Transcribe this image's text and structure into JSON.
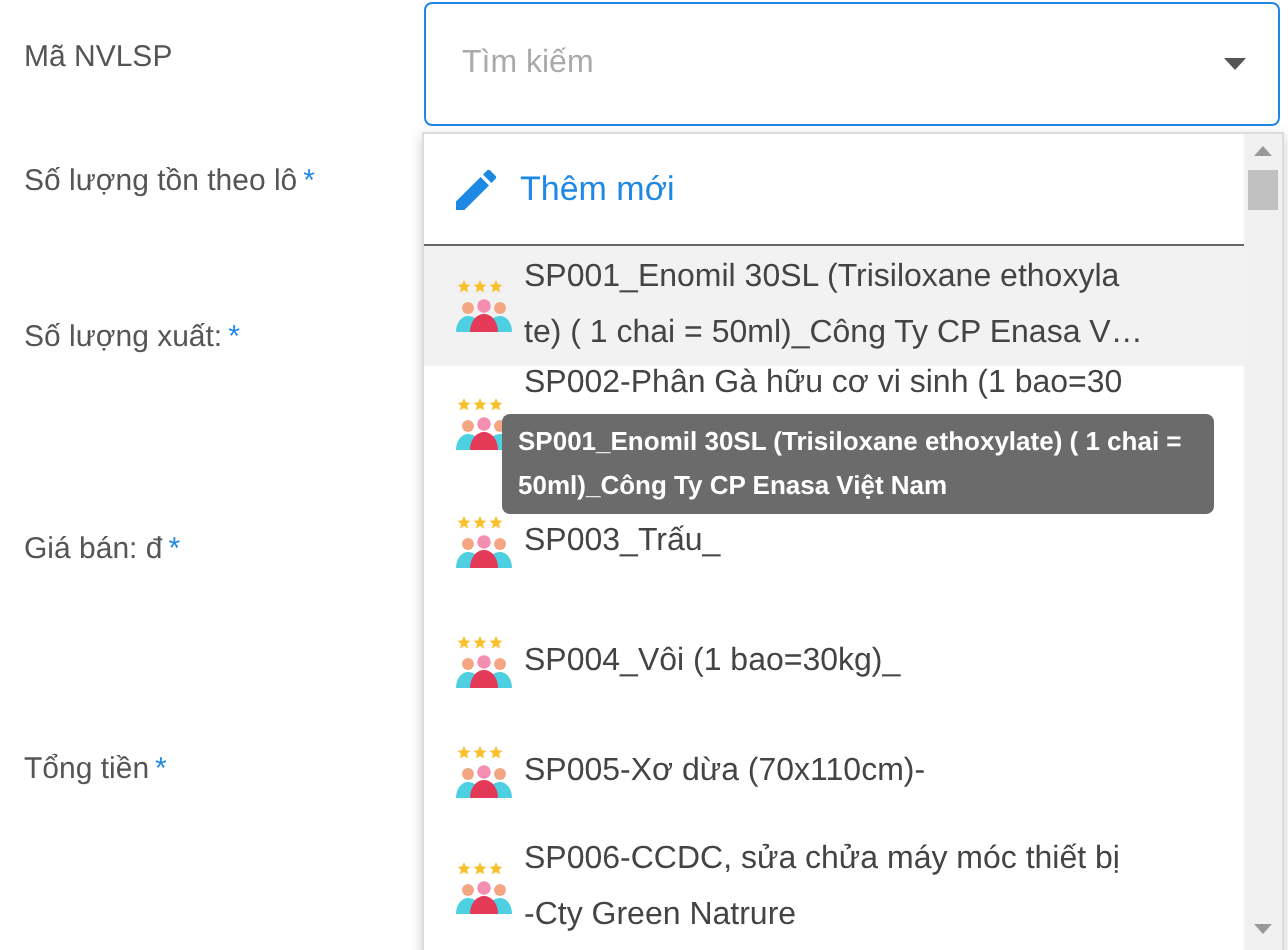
{
  "fields": [
    {
      "label": "Mã NVLSP"
    },
    {
      "label": "Số lượng tồn theo lô",
      "mark": "*"
    },
    {
      "label": "Số lượng xuất:",
      "mark": "*"
    },
    {
      "label": "Giá bán: đ",
      "mark": "*"
    },
    {
      "label": "Tổng tiền",
      "mark": "*"
    }
  ],
  "select": {
    "placeholder": "Tìm kiếm",
    "expanded": true
  },
  "dropdown": {
    "add_label": "Thêm mới",
    "items": [
      {
        "lines": [
          "SP001_Enomil 30SL (Trisiloxane ethoxyla",
          "te) ( 1 chai = 50ml)_Công Ty CP Enasa V…"
        ],
        "selected": true
      },
      {
        "lines": [
          "SP002-Phân Gà hữu cơ vi sinh (1 bao=30"
        ],
        "selected": false
      },
      {
        "lines": [
          "SP003_Trấu_"
        ],
        "selected": false
      },
      {
        "lines": [
          "SP004_Vôi (1 bao=30kg)_"
        ],
        "selected": false
      },
      {
        "lines": [
          "SP005-Xơ dừa (70x110cm)-"
        ],
        "selected": false
      },
      {
        "lines": [
          "SP006-CCDC, sửa chửa máy móc thiết bị",
          "-Cty Green Natrure"
        ],
        "selected": false
      }
    ]
  },
  "tooltip": {
    "lines": [
      "SP001_Enomil 30SL (Trisiloxane ethoxylate) ( 1 chai =",
      "50ml)_Công Ty CP Enasa Việt Nam"
    ]
  }
}
